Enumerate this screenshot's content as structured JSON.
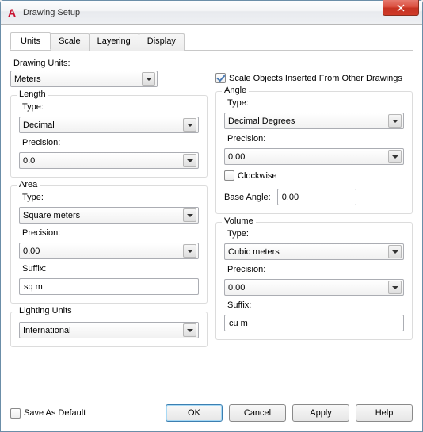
{
  "window": {
    "title": "Drawing Setup",
    "app_icon_letter": "A"
  },
  "tabs": {
    "units": "Units",
    "scale": "Scale",
    "layering": "Layering",
    "display": "Display"
  },
  "labels": {
    "drawing_units": "Drawing Units:",
    "type": "Type:",
    "precision": "Precision:",
    "suffix": "Suffix:",
    "length": "Length",
    "area": "Area",
    "lighting_units": "Lighting Units",
    "angle": "Angle",
    "volume": "Volume",
    "clockwise": "Clockwise",
    "base_angle": "Base Angle:",
    "scale_inserted": "Scale Objects Inserted From Other Drawings",
    "save_as_default": "Save As Default"
  },
  "drawing_units": {
    "value": "Meters"
  },
  "length": {
    "type": "Decimal",
    "precision": "0.0"
  },
  "area": {
    "type": "Square meters",
    "precision": "0.00",
    "suffix": "sq m"
  },
  "lighting": {
    "value": "International"
  },
  "scale_inserted_checked": true,
  "angle": {
    "type": "Decimal Degrees",
    "precision": "0.00",
    "clockwise": false,
    "base_angle": "0.00"
  },
  "volume": {
    "type": "Cubic meters",
    "precision": "0.00",
    "suffix": "cu m"
  },
  "save_as_default_checked": false,
  "buttons": {
    "ok": "OK",
    "cancel": "Cancel",
    "apply": "Apply",
    "help": "Help"
  }
}
